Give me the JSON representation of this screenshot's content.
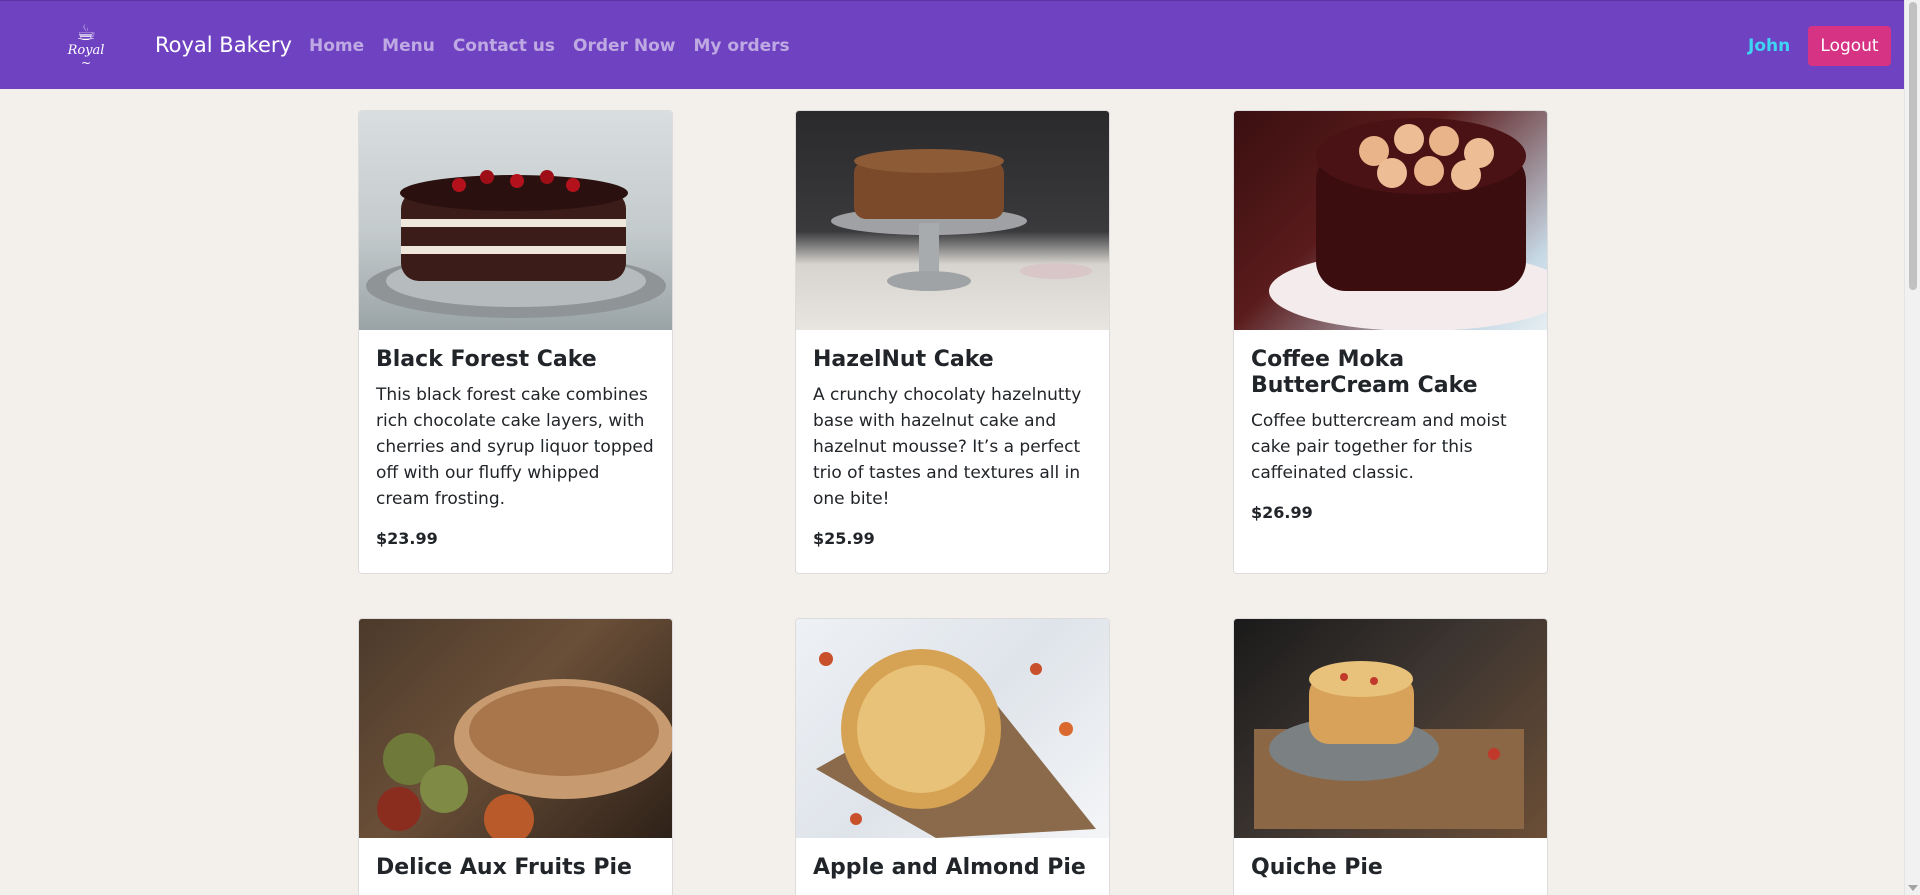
{
  "navbar": {
    "logo_text": "Royal",
    "brand": "Royal Bakery",
    "links": [
      "Home",
      "Menu",
      "Contact us",
      "Order Now",
      "My orders"
    ],
    "user": "John",
    "logout": "Logout"
  },
  "colors": {
    "navbar": "#6f42c1",
    "logout_button": "#d63384",
    "user_name": "#3dd5f3",
    "page_background": "#f3f0ec"
  },
  "products": [
    {
      "title": "Black Forest Cake",
      "description": "This black forest cake combines rich chocolate cake layers, with cherries and syrup liquor topped off with our fluffy whipped cream frosting.",
      "price": "$23.99"
    },
    {
      "title": "HazelNut Cake",
      "description": "A crunchy chocolaty hazelnutty base with hazelnut cake and hazelnut mousse? It’s a perfect trio of tastes and textures all in one bite!",
      "price": "$25.99"
    },
    {
      "title": "Coffee Moka ButterCream Cake",
      "description": "Coffee buttercream and moist cake pair together for this caffeinated classic.",
      "price": "$26.99"
    },
    {
      "title": "Delice Aux Fruits Pie"
    },
    {
      "title": "Apple and Almond Pie"
    },
    {
      "title": "Quiche Pie"
    }
  ]
}
